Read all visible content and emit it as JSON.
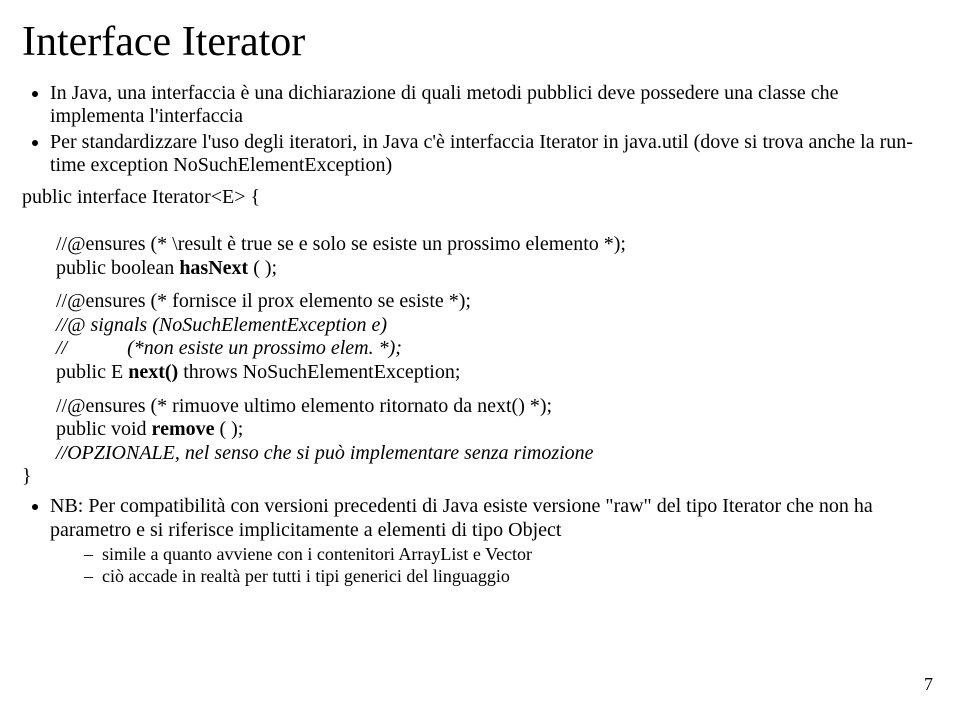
{
  "title": "Interface Iterator",
  "bullets_top": [
    "In Java, una interfaccia è una dichiarazione di quali metodi pubblici deve possedere una classe che implementa l'interfaccia",
    "Per standardizzare l'uso degli iteratori, in Java c'è interfaccia Iterator in java.util (dove si trova anche la run-time exception NoSuchElementException)"
  ],
  "code": {
    "decl": "public interface Iterator<E> {",
    "block1": {
      "l1": "//@ensures (* \\result è true se e solo se esiste un prossimo elemento *);",
      "l2a": "public boolean ",
      "l2b": "hasNext",
      "l2c": " ( );"
    },
    "block2": {
      "l1": "//@ensures (* fornisce il prox elemento se esiste *);",
      "l2": "//@ signals (NoSuchElementException e)",
      "l3a": "//",
      "l3b": "(*non esiste un prossimo elem. *);",
      "l4a": "public E ",
      "l4b": "next()",
      "l4c": " throws NoSuchElementException;"
    },
    "block3": {
      "l1": "//@ensures (* rimuove ultimo elemento ritornato da next() *);",
      "l2a": "public void ",
      "l2b": "remove",
      "l2c": " ( );",
      "l3": "//OPZIONALE, nel senso che si può implementare senza rimozione"
    },
    "close": "}"
  },
  "bullets_bottom": [
    "NB: Per compatibilità con versioni precedenti di Java esiste versione \"raw\" del tipo Iterator che non ha parametro e si riferisce implicitamente a elementi di tipo Object"
  ],
  "sub_bullets": [
    "simile a quanto avviene con i contenitori ArrayList e Vector",
    "ciò accade in realtà per tutti i tipi generici del linguaggio"
  ],
  "page_number": "7"
}
